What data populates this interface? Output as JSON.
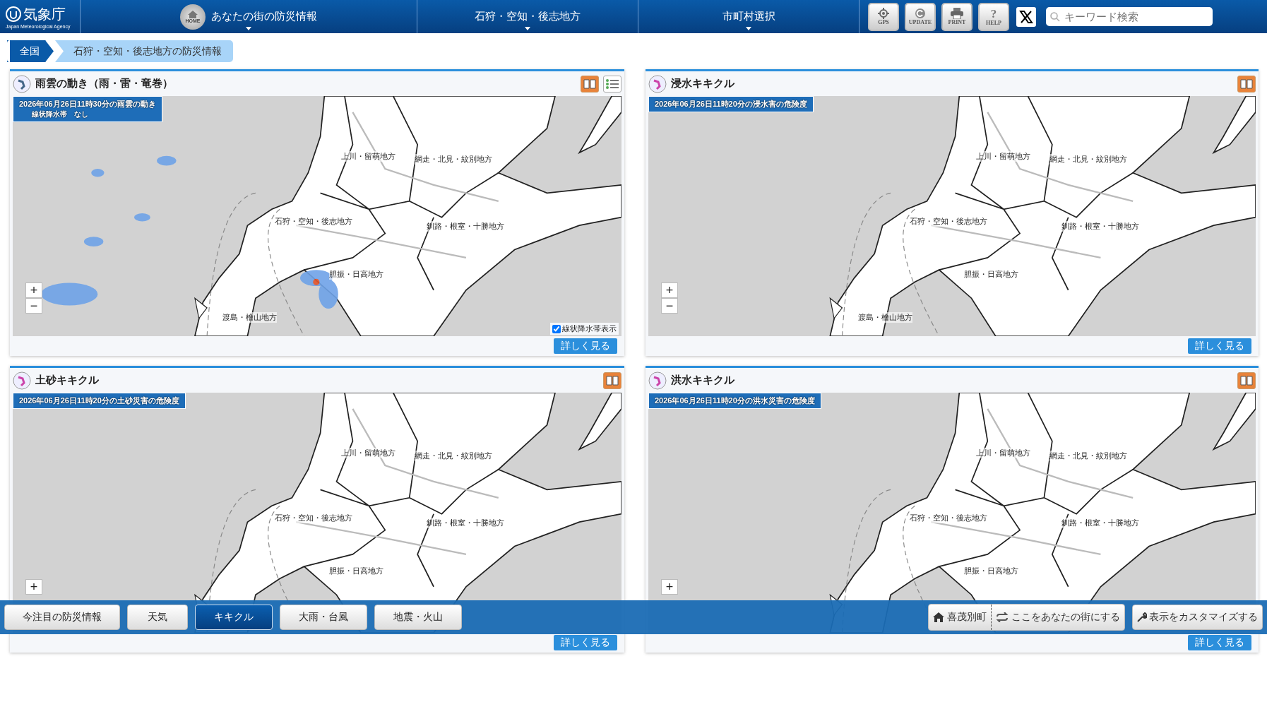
{
  "header": {
    "logo": {
      "name": "気象庁",
      "subtitle": "Japan Meteorological Agency"
    },
    "nav": [
      {
        "label": "あなたの街の防災情報",
        "icon_label": "HOME"
      },
      {
        "label": "石狩・空知・後志地方"
      },
      {
        "label": "市町村選択"
      }
    ],
    "tools": [
      {
        "kind": "gps",
        "label": "GPS"
      },
      {
        "kind": "update",
        "label": "UPDATE"
      },
      {
        "kind": "print",
        "label": "PRINT"
      },
      {
        "kind": "help",
        "label": "HELP",
        "glyph": "?"
      }
    ],
    "search": {
      "placeholder": "キーワード検索"
    }
  },
  "breadcrumb": [
    "全国",
    "石狩・空知・後志地方の防災情報"
  ],
  "panels": [
    {
      "kind": "rain",
      "title": "雨雲の動き（雨・雷・竜巻）",
      "timestamp": "2026年06月26日11時30分の雨雲の動き",
      "note": "線状降水帯　なし",
      "list_view": true,
      "zoom": [
        "+",
        "−"
      ],
      "map_labels": [
        "上川・留萌地方",
        "網走・北見・紋別地方",
        "石狩・空知・後志地方",
        "釧路・根室・十勝地方",
        "胆振・日高地方",
        "渡島・檜山地方"
      ],
      "overlay_toggle": {
        "label": "線状降水帯表示",
        "checked": true
      },
      "more": "詳しく見る"
    },
    {
      "kind": "risk",
      "title": "浸水キキクル",
      "timestamp": "2026年06月26日11時20分の浸水害の危険度",
      "zoom": [
        "+",
        "−"
      ],
      "map_labels": [
        "上川・留萌地方",
        "網走・北見・紋別地方",
        "石狩・空知・後志地方",
        "釧路・根室・十勝地方",
        "胆振・日高地方",
        "渡島・檜山地方"
      ],
      "more": "詳しく見る"
    },
    {
      "kind": "risk",
      "title": "土砂キキクル",
      "timestamp": "2026年06月26日11時20分の土砂災害の危険度",
      "zoom": [
        "+"
      ],
      "map_labels": [
        "上川・留萌地方",
        "網走・北見・紋別地方",
        "石狩・空知・後志地方",
        "釧路・根室・十勝地方",
        "胆振・日高地方"
      ],
      "more": "詳しく見る"
    },
    {
      "kind": "risk",
      "title": "洪水キキクル",
      "timestamp": "2026年06月26日11時20分の洪水災害の危険度",
      "zoom": [
        "+"
      ],
      "map_labels": [
        "上川・留萌地方",
        "網走・北見・紋別地方",
        "石狩・空知・後志地方",
        "釧路・根室・十勝地方",
        "胆振・日高地方"
      ],
      "more": "詳しく見る"
    }
  ],
  "bottom_bar": {
    "tabs": [
      {
        "label": "今注目の防災情報",
        "selected": false
      },
      {
        "label": "天気",
        "selected": false
      },
      {
        "label": "キキクル",
        "selected": true
      },
      {
        "label": "大雨・台風",
        "selected": false
      },
      {
        "label": "地震・火山",
        "selected": false
      }
    ],
    "location": "喜茂別町",
    "set_home": "ここをあなたの街にする",
    "customize": "表示をカスタマイズする"
  }
}
